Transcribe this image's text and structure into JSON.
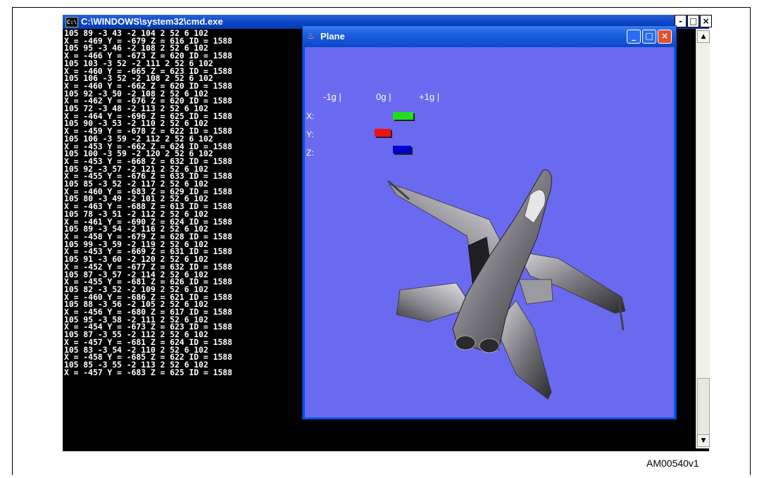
{
  "cmd_window": {
    "title": "C:\\WINDOWS\\system32\\cmd.exe",
    "icon": "cmd-icon",
    "lines": [
      "105 89 -3 43 -2 104 2 52 6 102",
      "X = -469 Y = -679 Z = 616 ID = 1588",
      "105 95 -3 46 -2 108 2 52 6 102",
      "X = -466 Y = -673 Z = 620 ID = 1588",
      "105 103 -3 52 -2 111 2 52 6 102",
      "X = -460 Y = -665 Z = 623 ID = 1588",
      "105 106 -3 52 -2 108 2 52 6 102",
      "X = -460 Y = -662 Z = 620 ID = 1588",
      "105 92 -3 50 -2 108 2 52 6 102",
      "X = -462 Y = -676 Z = 620 ID = 1588",
      "105 72 -3 48 -2 113 2 52 6 102",
      "X = -464 Y = -696 Z = 625 ID = 1588",
      "105 90 -3 53 -2 110 2 52 6 102",
      "X = -459 Y = -678 Z = 622 ID = 1588",
      "105 106 -3 59 -2 112 2 52 6 102",
      "X = -453 Y = -662 Z = 624 ID = 1588",
      "105 100 -3 59 -2 120 2 52 6 102",
      "X = -453 Y = -668 Z = 632 ID = 1588",
      "105 92 -3 57 -2 121 2 52 6 102",
      "X = -455 Y = -676 Z = 633 ID = 1588",
      "105 85 -3 52 -2 117 2 52 6 102",
      "X = -460 Y = -683 Z = 629 ID = 1588",
      "105 80 -3 49 -2 101 2 52 6 102",
      "X = -463 Y = -688 Z = 613 ID = 1588",
      "105 78 -3 51 -2 112 2 52 6 102",
      "X = -461 Y = -690 Z = 624 ID = 1588",
      "105 89 -3 54 -2 116 2 52 6 102",
      "X = -458 Y = -679 Z = 628 ID = 1588",
      "105 99 -3 59 -2 119 2 52 6 102",
      "X = -453 Y = -669 Z = 631 ID = 1588",
      "105 91 -3 60 -2 120 2 52 6 102",
      "X = -452 Y = -677 Z = 632 ID = 1588",
      "105 87 -3 57 -2 114 2 52 6 102",
      "X = -455 Y = -681 Z = 626 ID = 1588",
      "105 82 -3 52 -2 109 2 52 6 102",
      "X = -460 Y = -686 Z = 621 ID = 1588",
      "105 88 -3 56 -2 105 2 52 6 102",
      "X = -456 Y = -680 Z = 617 ID = 1588",
      "105 95 -3 58 -2 111 2 52 6 102",
      "X = -454 Y = -673 Z = 623 ID = 1588",
      "105 87 -3 55 -2 112 2 52 6 102",
      "X = -457 Y = -681 Z = 624 ID = 1588",
      "105 83 -3 54 -2 110 2 52 6 102",
      "X = -458 Y = -685 Z = 622 ID = 1588",
      "105 85 -3 55 -2 113 2 52 6 102",
      "X = -457 Y = -683 Z = 625 ID = 1588"
    ],
    "outer_controls": {
      "minimize": "-",
      "restore": "□",
      "close": "×"
    },
    "scroll_up": "▲",
    "scroll_down": "▼"
  },
  "plane_window": {
    "title": "Plane",
    "icon": "java-cup-icon",
    "controls": {
      "minimize": "_",
      "maximize": "□",
      "close": "×"
    },
    "scale_labels": {
      "neg": "-1g |",
      "zero": "0g |",
      "pos": "+1g |"
    },
    "axes": [
      {
        "label": "X:",
        "color": "#22dd22",
        "from_g": 0.0,
        "to_g": 0.45
      },
      {
        "label": "Y:",
        "color": "#ee1111",
        "from_g": -0.4,
        "to_g": -0.05
      },
      {
        "label": "Z:",
        "color": "#0000cc",
        "from_g": 0.0,
        "to_g": 0.4
      }
    ]
  },
  "caption": "AM00540v1"
}
